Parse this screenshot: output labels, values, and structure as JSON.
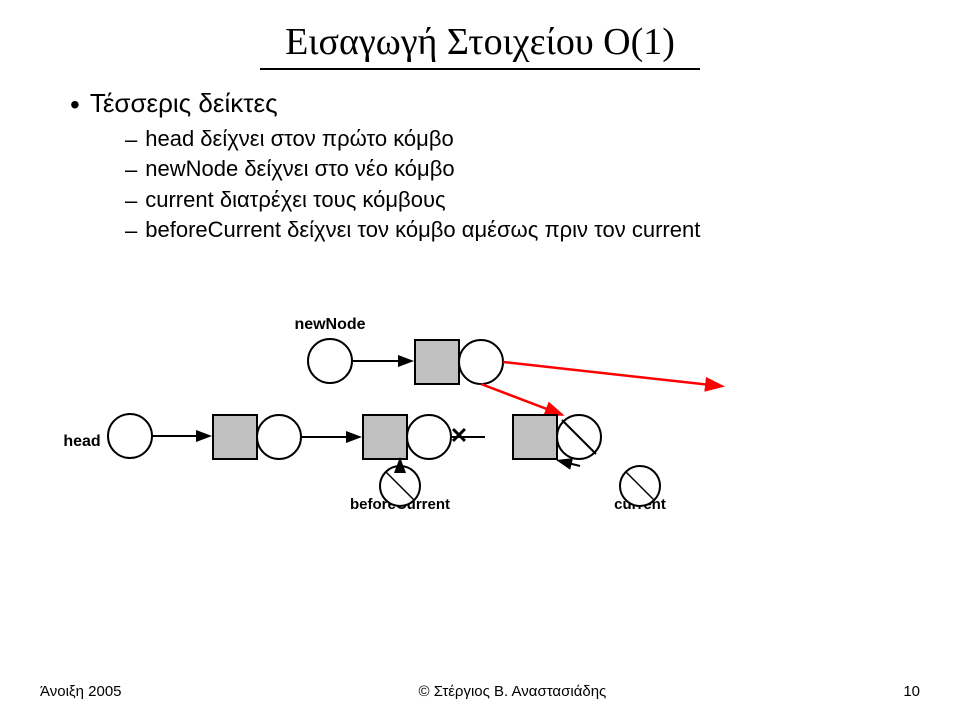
{
  "title": "Εισαγωγή Στοιχείου Ο(1)",
  "bullets": {
    "main": "Τέσσερις δείκτες",
    "sub": [
      "head δείχνει στον πρώτο κόμβο",
      "newNode δείχνει στο νέο κόμβο",
      "current διατρέχει τους κόμβους",
      "beforeCurrent δείχνει τον κόμβο αμέσως πριν τον current"
    ]
  },
  "diagram": {
    "newNode_label": "newNode",
    "head_label": "head",
    "beforeCurrent_label": "beforeCurrent",
    "current_label": "current"
  },
  "footer": {
    "left": "Άνοιξη 2005",
    "center": "© Στέργιος Β. Αναστασιάδης",
    "right": "10"
  }
}
